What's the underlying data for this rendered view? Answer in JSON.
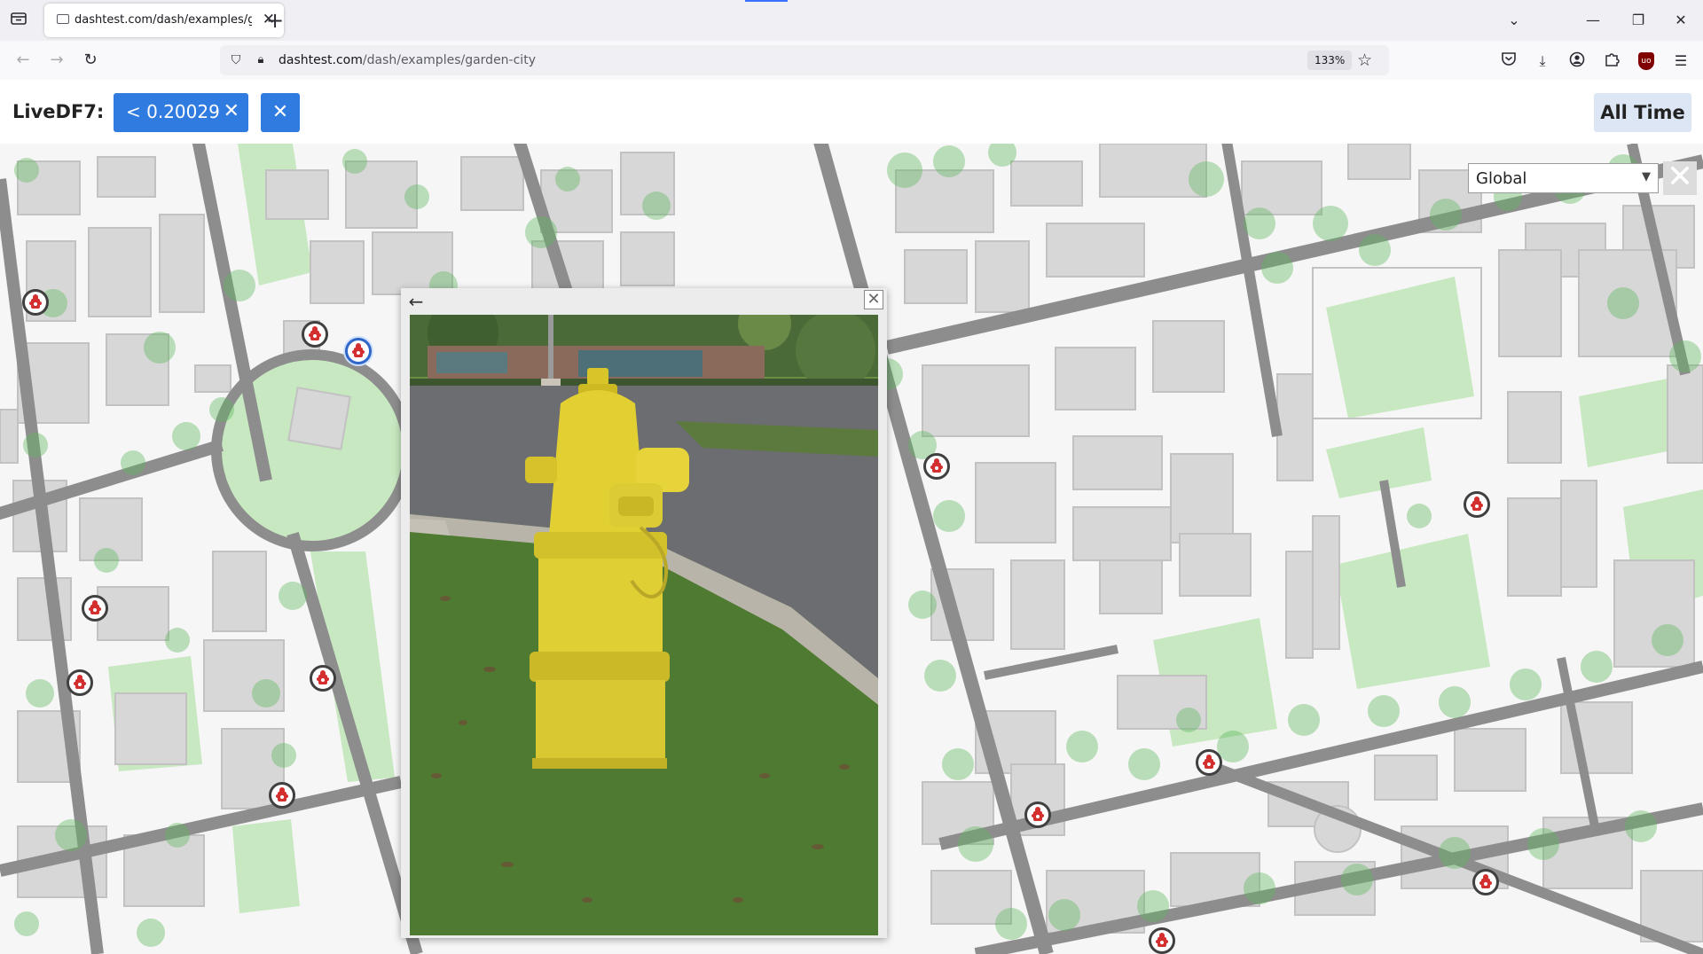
{
  "browser": {
    "tab_title": "dashtest.com/dash/examples/garden-city",
    "url_host": "dashtest.com",
    "url_path": "/dash/examples/garden-city",
    "zoom": "133%"
  },
  "toolbar": {
    "label": "LiveDF7:",
    "filter_chip": "< 0.20029",
    "time_range_button": "All Time"
  },
  "map": {
    "scope_select": {
      "selected": "Global"
    },
    "colors": {
      "building": "#d7d7d7",
      "building_edge": "#c2c2c2",
      "road": "#8d8d8d",
      "park": "#c7e8c0",
      "tree": "#5cb85c",
      "marker_ring": "#404040",
      "marker_selected_ring": "#2f66c9",
      "hydrant_red": "#d32f2f"
    },
    "hydrant_marker_count": 15
  },
  "photo_popup": {
    "subject": "yellow fire hydrant on grass beside road"
  },
  "icons": {
    "tab_list": "folder-tabs-icon",
    "back": "arrow-left-icon",
    "forward": "arrow-right-icon",
    "reload": "reload-icon",
    "tracking": "shield-icon",
    "lock": "lock-icon",
    "bookmark": "star-icon",
    "pocket": "pocket-icon",
    "downloads": "download-icon",
    "account": "account-icon",
    "extensions": "puzzle-icon",
    "ublock": "ublock-icon",
    "menu": "hamburger-icon"
  }
}
